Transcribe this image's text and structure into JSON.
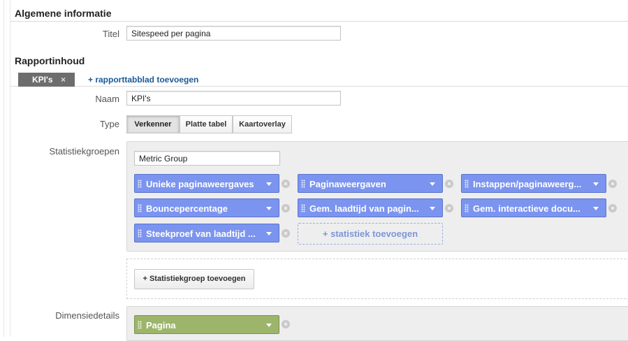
{
  "general": {
    "heading": "Algemene informatie",
    "title_label": "Titel",
    "title_value": "Sitespeed per pagina"
  },
  "content": {
    "heading": "Rapportinhoud",
    "active_tab": "KPI's",
    "tab_close": "×",
    "add_tab_link": "+ rapporttabblad toevoegen",
    "name_label": "Naam",
    "name_value": "KPI's",
    "type_label": "Type",
    "type_options": [
      "Verkenner",
      "Platte tabel",
      "Kaartoverlay"
    ],
    "type_selected": "Verkenner"
  },
  "metrics": {
    "label": "Statistiekgroepen",
    "group_name": "Metric Group",
    "chips": [
      "Unieke paginaweergaves",
      "Paginaweergaven",
      "Instappen/paginaweerg...",
      "Bouncepercentage",
      "Gem. laadtijd van pagin...",
      "Gem. interactieve docu...",
      "Steekproef van laadtijd ..."
    ],
    "add_metric": "+ statistiek toevoegen",
    "add_group_button": "+ Statistiekgroep toevoegen",
    "chip_color": "#7b94ef"
  },
  "dimensions": {
    "label": "Dimensiedetails",
    "chips": [
      "Pagina"
    ],
    "chip_color": "#9db56b"
  },
  "icons": {
    "remove": "×"
  }
}
